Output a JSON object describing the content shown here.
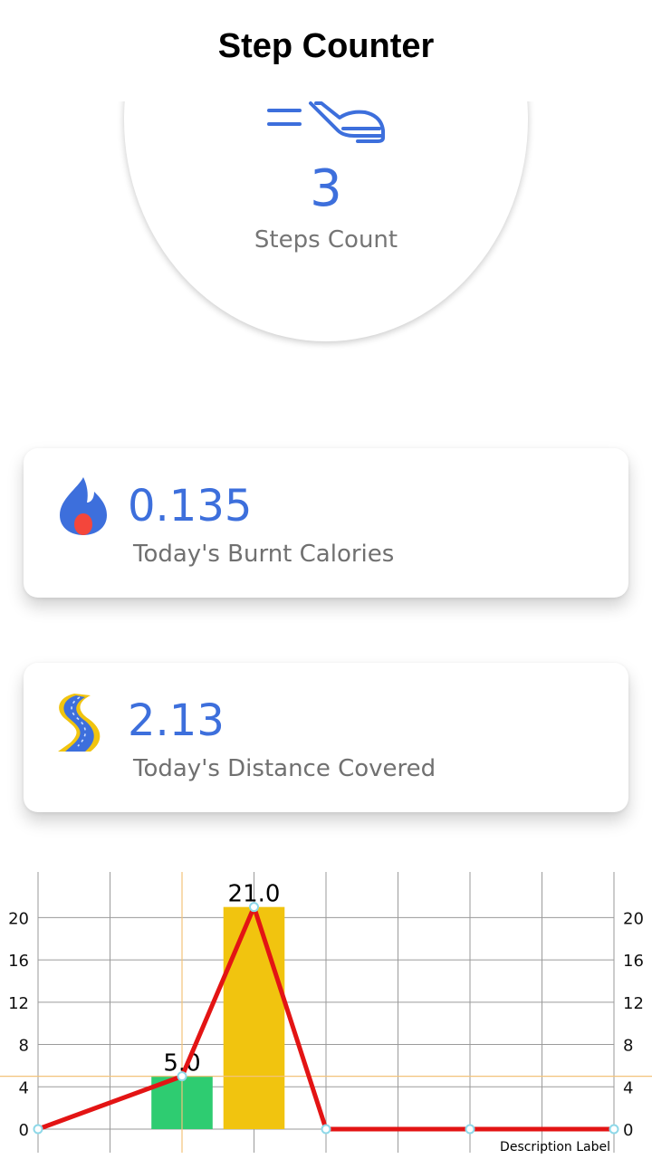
{
  "header": {
    "title": "Step Counter"
  },
  "steps": {
    "value": "3",
    "label": "Steps Count",
    "icon": "shoe-icon"
  },
  "calories": {
    "value": "0.135",
    "label": "Today's Burnt Calories",
    "icon": "flame-icon"
  },
  "distance": {
    "value": "2.13",
    "label": "Today's Distance Covered",
    "icon": "road-icon"
  },
  "colors": {
    "accent": "#3d6fdc",
    "bar_green": "#2ecc71",
    "bar_yellow": "#f1c40f",
    "line_red": "#e31414"
  },
  "chart_data": {
    "type": "bar",
    "description": "Description Label",
    "ylim": [
      0,
      22
    ],
    "yticks": [
      0,
      4,
      8,
      12,
      16,
      20
    ],
    "grid": true,
    "bars": [
      {
        "x": 2,
        "value": 5.0,
        "label": "5.0",
        "color": "#2ecc71"
      },
      {
        "x": 3,
        "value": 21.0,
        "label": "21.0",
        "color": "#f1c40f"
      }
    ],
    "line": {
      "x": [
        0,
        2,
        3,
        4,
        6,
        8
      ],
      "y": [
        0,
        5,
        21,
        0,
        0,
        0
      ],
      "color": "#e31414"
    }
  }
}
